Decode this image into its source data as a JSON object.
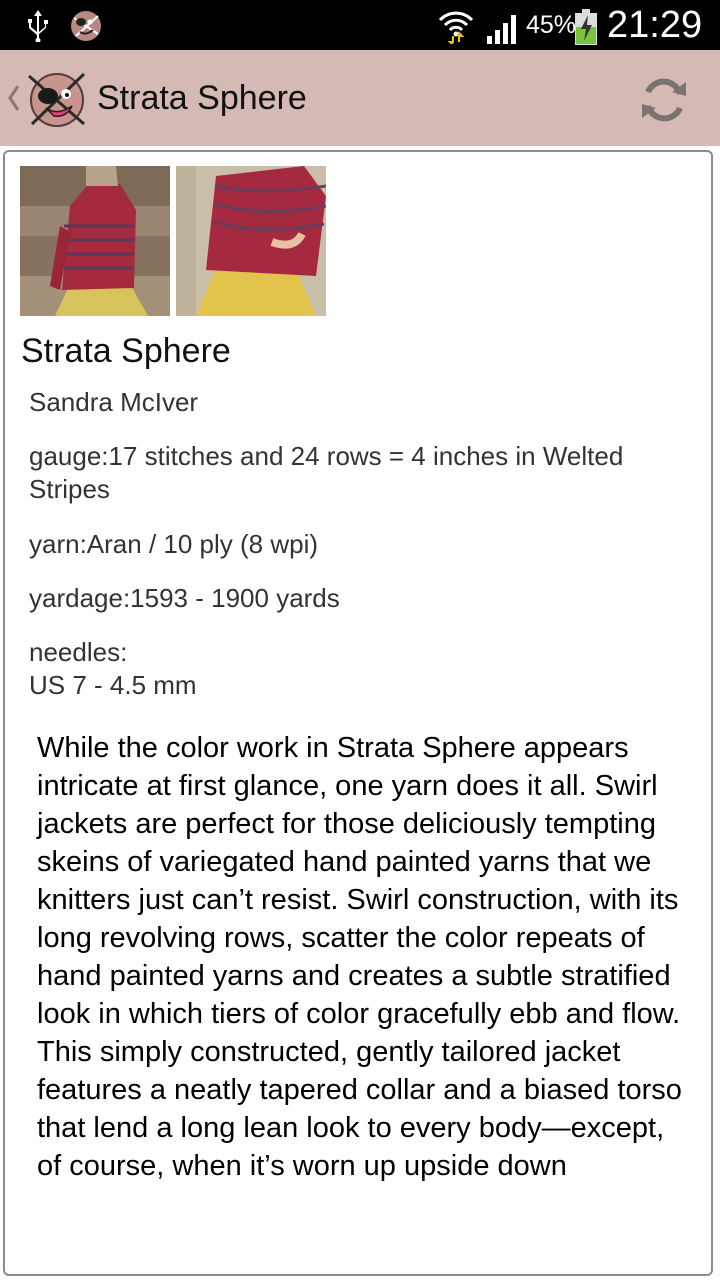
{
  "status_bar": {
    "battery_percent": "45%",
    "clock": "21:29",
    "icons": [
      "usb-icon",
      "app-notification-icon",
      "wifi-icon",
      "signal-icon",
      "battery-charging-icon"
    ]
  },
  "action_bar": {
    "title": "Strata Sphere",
    "icons": [
      "back-chevron-icon",
      "app-logo-icon",
      "refresh-icon"
    ],
    "color": "#d5b9b5"
  },
  "pattern": {
    "title": "Strata Sphere",
    "designer": "Sandra McIver",
    "gauge": "gauge:17 stitches and 24 rows = 4 inches in Welted Stripes",
    "yarn": "yarn:Aran / 10 ply (8 wpi)",
    "yardage": "yardage:1593 - 1900 yards",
    "needles_label": "needles:",
    "needles_value": "US 7  - 4.5 mm",
    "description": "While the color work in Strata Sphere appears intricate at first glance, one yarn does it all. Swirl jackets are perfect for those deliciously tempting skeins of variegated hand painted yarns that we knitters just can’t resist. Swirl construction, with its long revolving rows, scatter the color repeats of hand painted yarns and creates a subtle stratified look in which tiers of color gracefully ebb and flow. This simply constructed, gently tailored jacket features a neatly tapered collar and a biased torso that lend a long lean look to every body—except, of course, when it’s worn up upside down"
  }
}
